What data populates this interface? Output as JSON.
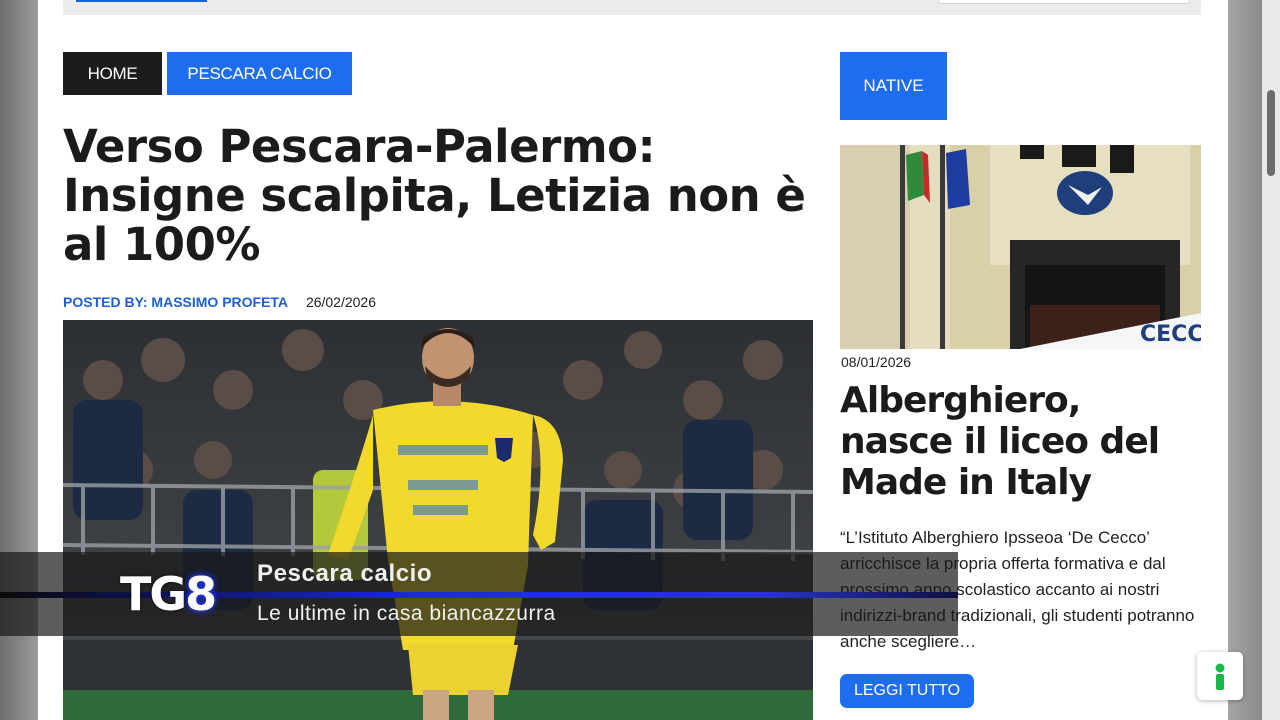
{
  "breadcrumb": {
    "home_label": "HOME",
    "category_label": "PESCARA CALCIO"
  },
  "article": {
    "title": "Verso Pescara-Palermo: Insigne scalpita, Letizia non è al 100%",
    "author": "POSTED BY: MASSIMO PROFETA",
    "date": "26/02/2026",
    "image_icon": "football-player-photo"
  },
  "sidebar": {
    "badge_label": "NATIVE",
    "post": {
      "image_icon": "school-building-photo",
      "date": "08/01/2026",
      "title": "Alberghiero, nasce il liceo del Made in Italy",
      "excerpt": "“L’Istituto Alberghiero Ipsseoa ‘De Cecco’ arricchisce la propria offerta formativa e dal prossimo anno scolastico accanto ai nostri indirizzi-brand tradizionali, gli studenti potranno anche scegliere…",
      "read_more_label": "LEGGI TUTTO"
    }
  },
  "accessibility_icon": "accessibility-icon",
  "tv_overlay": {
    "logo_tg": "TG",
    "logo_num": "8",
    "title": "Pescara calcio",
    "subtitle": "Le ultime in casa biancazzurra"
  },
  "colors": {
    "accent_blue": "#1e6df0",
    "dark": "#1c1c1c",
    "jersey_yellow": "#f2d92c"
  }
}
